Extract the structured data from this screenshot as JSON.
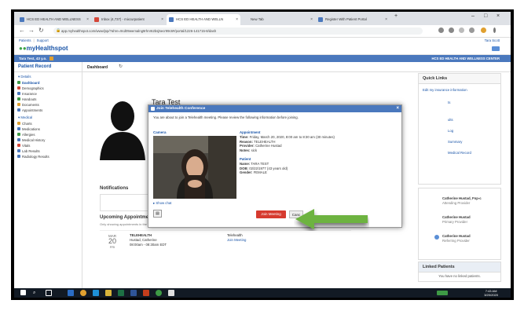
{
  "browser": {
    "tabs": [
      {
        "label": "HCS ED HEALTH AND WELLNESS"
      },
      {
        "label": "Inbox (4,737) - mixcurpatient"
      },
      {
        "label": "HCS ED HEALTH AND WELLN"
      },
      {
        "label": "New Tab"
      },
      {
        "label": "Register With Patient Portal"
      }
    ],
    "url": "app.myhealthspot.com/www/jsp/?ahre=9cd09wemalng9rhnr62bsj5ecr99c6#/portal/1226-141715-8/dash",
    "bookmarks": [
      "Patients",
      "Support"
    ],
    "user": "Tara Scott"
  },
  "app": {
    "logo": "myHealthspot",
    "patient_bar": "Tara Test, 43 y.o.",
    "center_name": "HCS ED HEALTH AND WELLNESS CENTER"
  },
  "sidebar": {
    "title": "Patient Record",
    "sections": [
      {
        "label": "Details",
        "items": [
          "Dashboard",
          "Demographics",
          "Insurance",
          "Handouts",
          "Documents",
          "Appointments"
        ]
      },
      {
        "label": "Medical",
        "items": [
          "Charts",
          "Medications",
          "Allergies",
          "Medical History",
          "Vitals",
          "Lab Results",
          "Radiology Results"
        ]
      }
    ]
  },
  "main": {
    "tab": "Dashboard",
    "patient_name": "Tara Test",
    "notifications_title": "Notifications",
    "upcoming_title": "Upcoming Appointments",
    "upcoming_sub": "Only showing appointments in the",
    "appointment": {
      "month": "MAR",
      "day": "20",
      "weekday": "FRI",
      "type": "TELEHEALTH",
      "provider": "Hustad, Catherine",
      "time": "08:00am - 08:30am EDT",
      "kind": "Telehealth",
      "action": "Join Meeting"
    }
  },
  "quick_links": {
    "title": "Quick Links",
    "items": [
      "Edit my insurance information",
      "ts",
      "ults",
      "Log",
      "Summary",
      "Medical Record"
    ]
  },
  "care_team": {
    "members": [
      {
        "name": "Catherine Hustad, Fnp-c",
        "role": "Attending Provider"
      },
      {
        "name": "Catherine Hustad",
        "role": "Primary Provider"
      },
      {
        "name": "Catherine Hustad",
        "role": "Referring Provider"
      }
    ]
  },
  "linked_patients": {
    "title": "Linked Patients",
    "empty": "You have no linked patients."
  },
  "modal": {
    "title": "Join Telehealth Conference",
    "intro": "You are about to join a Telehealth meeting. Please review the following information before joining.",
    "camera_label": "Camera",
    "appointment_label": "Appointment",
    "time_label": "Time:",
    "time_value": "Friday, March 20, 2020, 8:00 am to 8:30 am (30 minutes)",
    "reason_label": "Reason:",
    "reason_value": "TELEHEALTH",
    "provider_label": "Provider:",
    "provider_value": "Catherine Hustad",
    "notes_label": "Notes:",
    "notes_value": "sick",
    "patient_label": "Patient",
    "name_label": "Name:",
    "name_value": "TARA TEST",
    "dob_label": "DOB:",
    "dob_value": "02/22/1977 (43 years old)",
    "gender_label": "Gender:",
    "gender_value": "FEMALE",
    "show_chat": "Show chat",
    "join_button": "Join Meeting",
    "cancel_button": "Canc"
  },
  "taskbar": {
    "time": "7:43 AM",
    "date": "3/20/2020"
  },
  "colors": {
    "brand_blue": "#4a78bd",
    "join_red": "#d63a2f",
    "arrow_green": "#6db33f"
  }
}
